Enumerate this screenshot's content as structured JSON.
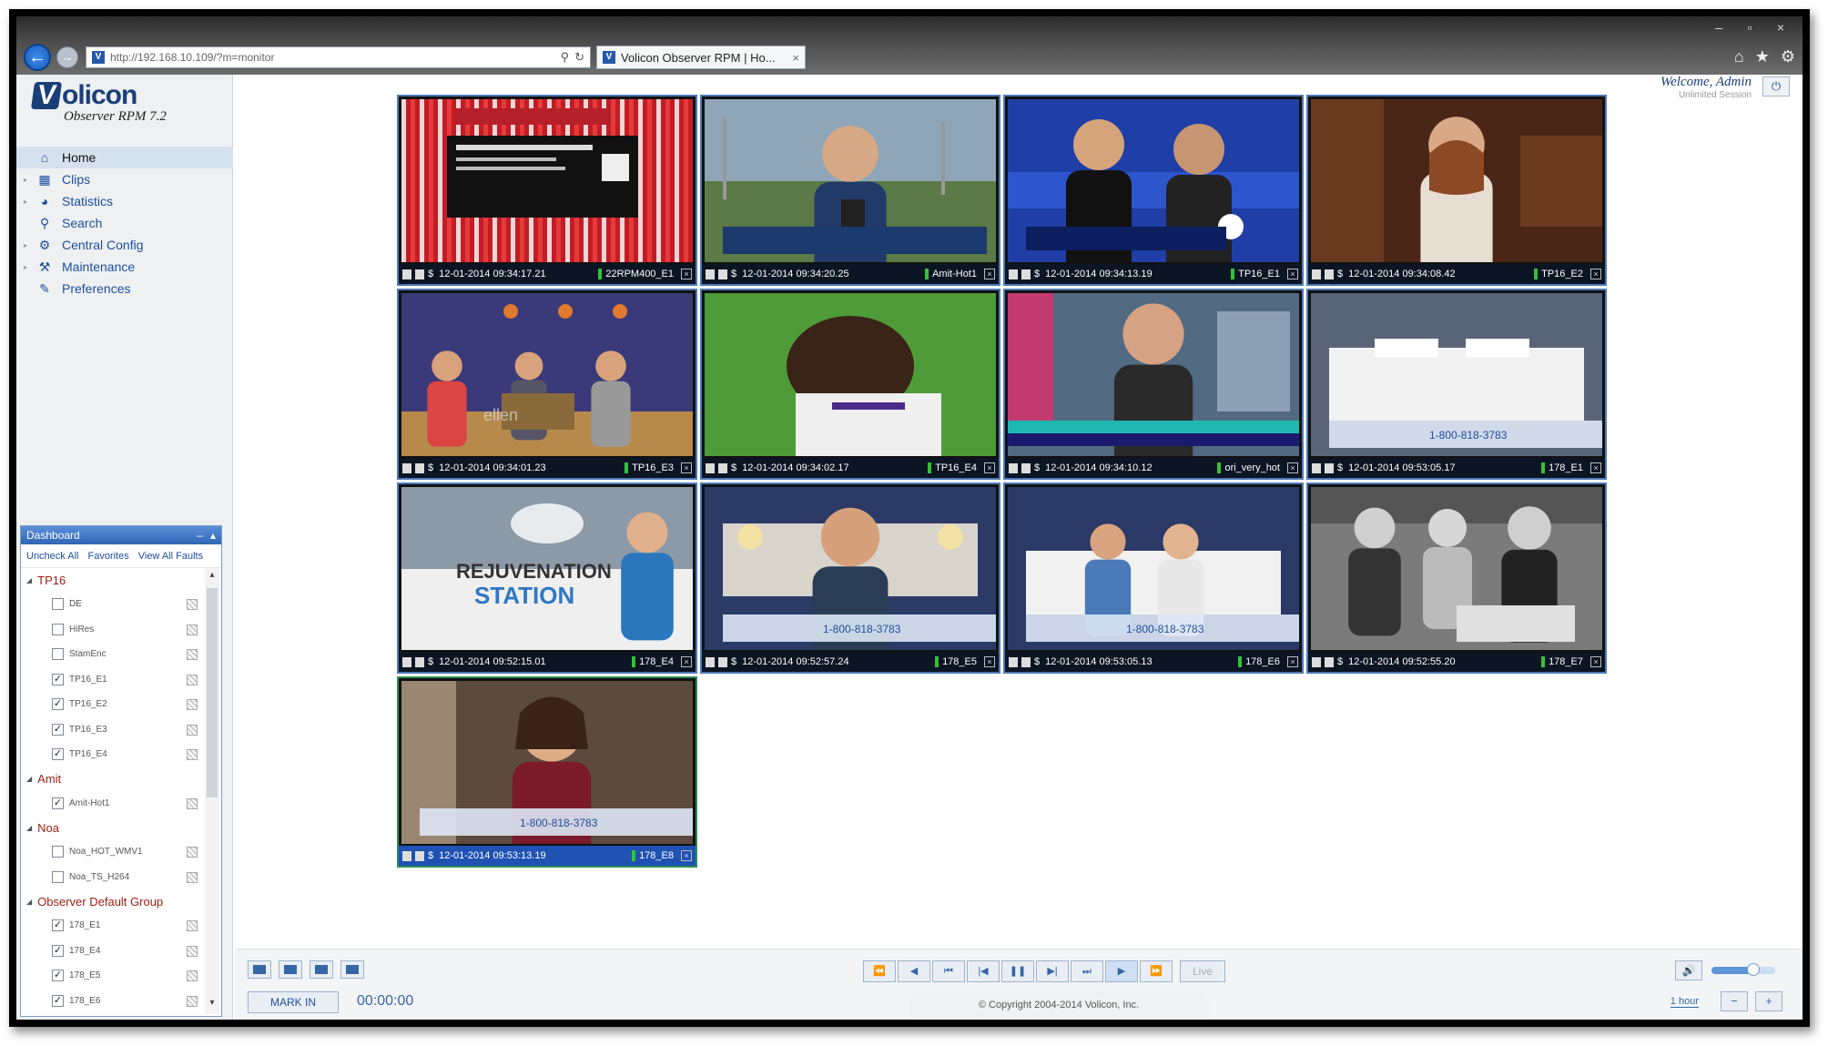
{
  "browser": {
    "url": "http://192.168.10.109/?m=monitor",
    "tab_title": "Volicon Observer RPM | Ho...",
    "tab_close": "×",
    "window_controls": [
      "–",
      "▫",
      "×"
    ],
    "toolbar_icons": [
      "home-icon",
      "star-icon",
      "gear-icon"
    ]
  },
  "logo": {
    "brand": "olicon",
    "brand_letter": "V",
    "subtitle": "Observer RPM 7.2"
  },
  "header": {
    "welcome": "Welcome, Admin",
    "session": "Unlimited Session"
  },
  "menu": {
    "items": [
      {
        "label": "Home",
        "icon": "home-icon",
        "glyph": "⌂",
        "arrow": ""
      },
      {
        "label": "Clips",
        "icon": "film-icon",
        "glyph": "▦",
        "arrow": "▸"
      },
      {
        "label": "Statistics",
        "icon": "pie-chart-icon",
        "glyph": "◕",
        "arrow": "▸"
      },
      {
        "label": "Search",
        "icon": "search-icon",
        "glyph": "⚲",
        "arrow": ""
      },
      {
        "label": "Central Config",
        "icon": "gear-icon",
        "glyph": "⚙",
        "arrow": "▸"
      },
      {
        "label": "Maintenance",
        "icon": "tools-icon",
        "glyph": "⚒",
        "arrow": "▸"
      },
      {
        "label": "Preferences",
        "icon": "wrench-icon",
        "glyph": "✎",
        "arrow": ""
      }
    ]
  },
  "dashboard": {
    "title": "Dashboard",
    "controls": [
      "–",
      "▴"
    ],
    "links": [
      "Uncheck All",
      "Favorites",
      "View All Faults"
    ],
    "scroll_up": "▴",
    "scroll_down": "▾",
    "groups": [
      {
        "name": "TP16",
        "channels": [
          {
            "label": "DE",
            "checked": false
          },
          {
            "label": "HiRes",
            "checked": false
          },
          {
            "label": "StamEnc",
            "checked": false
          },
          {
            "label": "TP16_E1",
            "checked": true
          },
          {
            "label": "TP16_E2",
            "checked": true
          },
          {
            "label": "TP16_E3",
            "checked": true
          },
          {
            "label": "TP16_E4",
            "checked": true
          }
        ]
      },
      {
        "name": "Amit",
        "channels": [
          {
            "label": "Amit-Hot1",
            "checked": true
          }
        ]
      },
      {
        "name": "Noa",
        "channels": [
          {
            "label": "Noa_HOT_WMV1",
            "checked": false
          },
          {
            "label": "Noa_TS_H264",
            "checked": false
          }
        ]
      },
      {
        "name": "Observer Default Group",
        "channels": [
          {
            "label": "178_E1",
            "checked": true
          },
          {
            "label": "178_E4",
            "checked": true
          },
          {
            "label": "178_E5",
            "checked": true
          },
          {
            "label": "178_E6",
            "checked": true
          }
        ]
      }
    ]
  },
  "tiles": [
    {
      "timestamp": "12-01-2014 09:34:17.21",
      "channel": "22RPM400_E1",
      "scene": "red-curtain",
      "selected": false
    },
    {
      "timestamp": "12-01-2014 09:34:20.25",
      "channel": "Amit-Hot1",
      "scene": "interview-outdoor",
      "selected": false
    },
    {
      "timestamp": "12-01-2014 09:34:13.19",
      "channel": "TP16_E1",
      "scene": "sports-studio",
      "selected": false
    },
    {
      "timestamp": "12-01-2014 09:34:08.42",
      "channel": "TP16_E2",
      "scene": "talk-show-dress",
      "selected": false
    },
    {
      "timestamp": "12-01-2014 09:34:01.23",
      "channel": "TP16_E3",
      "scene": "ellen-stage",
      "selected": false
    },
    {
      "timestamp": "12-01-2014 09:34:02.17",
      "channel": "TP16_E4",
      "scene": "soccer-player",
      "selected": false
    },
    {
      "timestamp": "12-01-2014 09:34:10.12",
      "channel": "ori_very_hot",
      "scene": "news-interview",
      "selected": false
    },
    {
      "timestamp": "12-01-2014 09:53:05.17",
      "channel": "178_E1",
      "scene": "bed-ad",
      "selected": false
    },
    {
      "timestamp": "12-01-2014 09:52:15.01",
      "channel": "178_E4",
      "scene": "rejuvenation-station",
      "selected": false
    },
    {
      "timestamp": "12-01-2014 09:52:57.24",
      "channel": "178_E5",
      "scene": "bedroom-man",
      "selected": false
    },
    {
      "timestamp": "12-01-2014 09:53:05.13",
      "channel": "178_E6",
      "scene": "bedroom-couple",
      "selected": false
    },
    {
      "timestamp": "12-01-2014 09:52:55.20",
      "channel": "178_E7",
      "scene": "bw-movie",
      "selected": false
    },
    {
      "timestamp": "12-01-2014 09:53:13.19",
      "channel": "178_E8",
      "scene": "woman-bedroom",
      "selected": true
    }
  ],
  "tile_overlay": {
    "rejuvenation_line1": "REJUVENATION",
    "rejuvenation_line2": "STATION",
    "phone": "1-800-818-3783",
    "ellen": "ellen"
  },
  "player": {
    "mark_in": "MARK IN",
    "timecode": "00:00:00",
    "live": "Live",
    "buttons": [
      "⏪",
      "◀",
      "⏮",
      "|◀",
      "❚❚",
      "▶|",
      "⏭",
      "▶",
      "⏩"
    ],
    "copyright": "© Copyright 2004-2014 Volicon, Inc.",
    "zoom_label": "1 hour",
    "volume_level": 0.65
  },
  "colors": {
    "accent": "#1d4f9c",
    "group_text": "#9a1d12",
    "tile_border_blue": "#4f79b8",
    "tile_border_green": "#2e8c56",
    "signal": "#33c23a"
  }
}
